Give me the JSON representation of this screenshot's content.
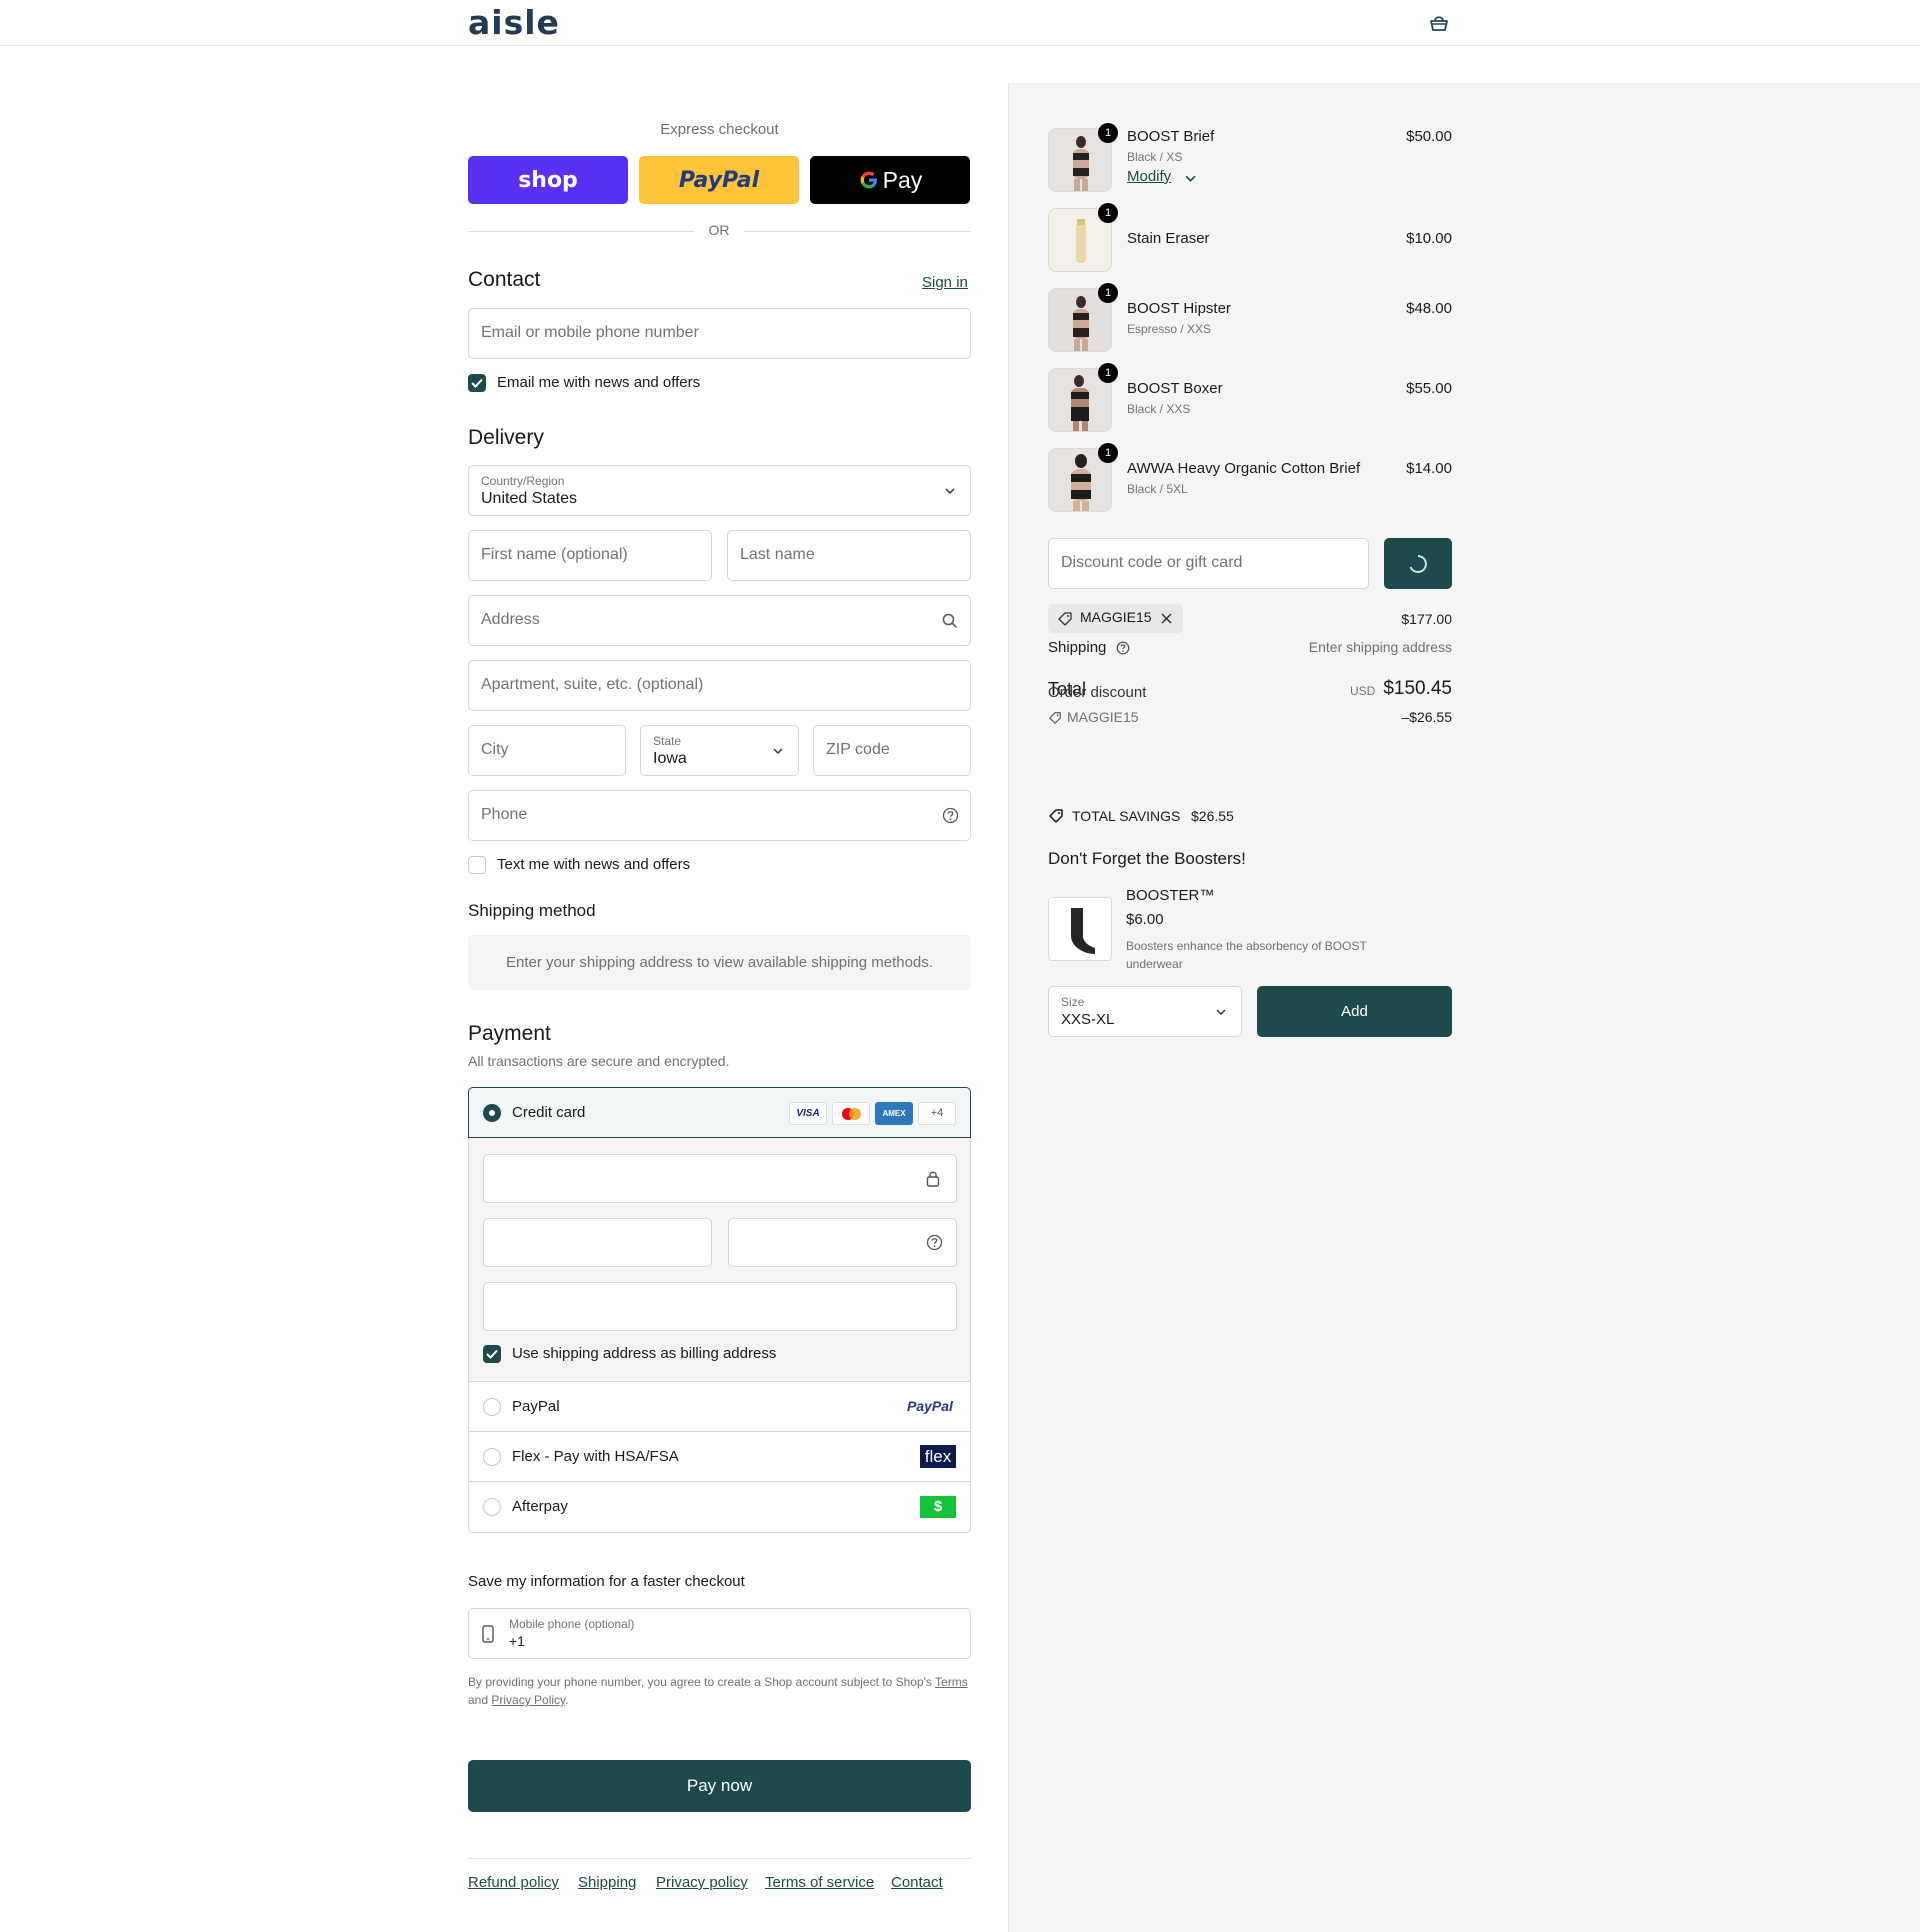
{
  "brand": {
    "logo_text": "aisle",
    "accent": "#1d4a4c"
  },
  "header": {
    "cart_icon": "cart-icon"
  },
  "express": {
    "title": "Express checkout",
    "shop_label": "shop",
    "paypal_label": "PayPal",
    "gpay_label": "Pay",
    "or_label": "OR"
  },
  "contact": {
    "title": "Contact",
    "sign_in": "Sign in",
    "email_placeholder": "Email or mobile phone number",
    "news_checkbox": "Email me with news and offers"
  },
  "delivery": {
    "title": "Delivery",
    "country_label": "Country/Region",
    "country_value": "United States",
    "first_name_placeholder": "First name (optional)",
    "last_name_placeholder": "Last name",
    "address_placeholder": "Address",
    "apartment_placeholder": "Apartment, suite, etc. (optional)",
    "city_placeholder": "City",
    "state_label": "State",
    "state_value": "Iowa",
    "zip_placeholder": "ZIP code",
    "phone_placeholder": "Phone",
    "text_checkbox": "Text me with news and offers"
  },
  "shipping_method": {
    "title": "Shipping method",
    "notice": "Enter your shipping address to view available shipping methods."
  },
  "payment": {
    "title": "Payment",
    "subtitle": "All transactions are secure and encrypted.",
    "credit_card_label": "Credit card",
    "card_badges": [
      "VISA",
      "AMEX",
      "+4"
    ],
    "billing_checkbox": "Use shipping address as billing address",
    "paypal_label": "PayPal",
    "paypal_logo": "PayPal",
    "flex_label": "Flex - Pay with HSA/FSA",
    "flex_logo": "flex",
    "afterpay_label": "Afterpay",
    "afterpay_logo": "$"
  },
  "save_info": {
    "title": "Save my information for a faster checkout",
    "mobile_label": "Mobile phone (optional)",
    "mobile_value": "+1",
    "legal_prefix": "By providing your phone number, you agree to create a Shop account subject to Shop's",
    "terms": "Terms",
    "and": "and",
    "privacy": "Privacy Policy",
    "period": "."
  },
  "pay_now": "Pay now",
  "footer": [
    "Refund policy",
    "Shipping",
    "Privacy policy",
    "Terms of service",
    "Contact"
  ],
  "cart": {
    "items": [
      {
        "qty": "1",
        "name": "BOOST Brief",
        "variant": "Black / XS",
        "price": "$50.00",
        "modify": "Modify"
      },
      {
        "qty": "1",
        "name": "Stain Eraser",
        "variant": "",
        "price": "$10.00"
      },
      {
        "qty": "1",
        "name": "BOOST Hipster",
        "variant": "Espresso / XXS",
        "price": "$48.00"
      },
      {
        "qty": "1",
        "name": "BOOST Boxer",
        "variant": "Black / XXS",
        "price": "$55.00"
      },
      {
        "qty": "1",
        "name": "AWWA Heavy Organic Cotton Brief",
        "variant": "Black / 5XL",
        "price": "$14.00"
      }
    ],
    "discount_placeholder": "Discount code or gift card",
    "applied_code": "MAGGIE15",
    "subtotal_value": "$177.00",
    "shipping_label": "Shipping",
    "shipping_value": "Enter shipping address",
    "total_label": "Total",
    "order_discount_label": "Order discount",
    "currency": "USD",
    "total_value": "$150.45",
    "discount_code": "MAGGIE15",
    "discount_value": "–$26.55",
    "savings_label": "TOTAL SAVINGS",
    "savings_value": "$26.55"
  },
  "upsell": {
    "title": "Don't Forget the Boosters!",
    "product_name": "BOOSTER™",
    "product_price": "$6.00",
    "product_desc": "Boosters enhance the absorbency of BOOST underwear",
    "size_label": "Size",
    "size_value": "XXS-XL",
    "add_label": "Add"
  }
}
